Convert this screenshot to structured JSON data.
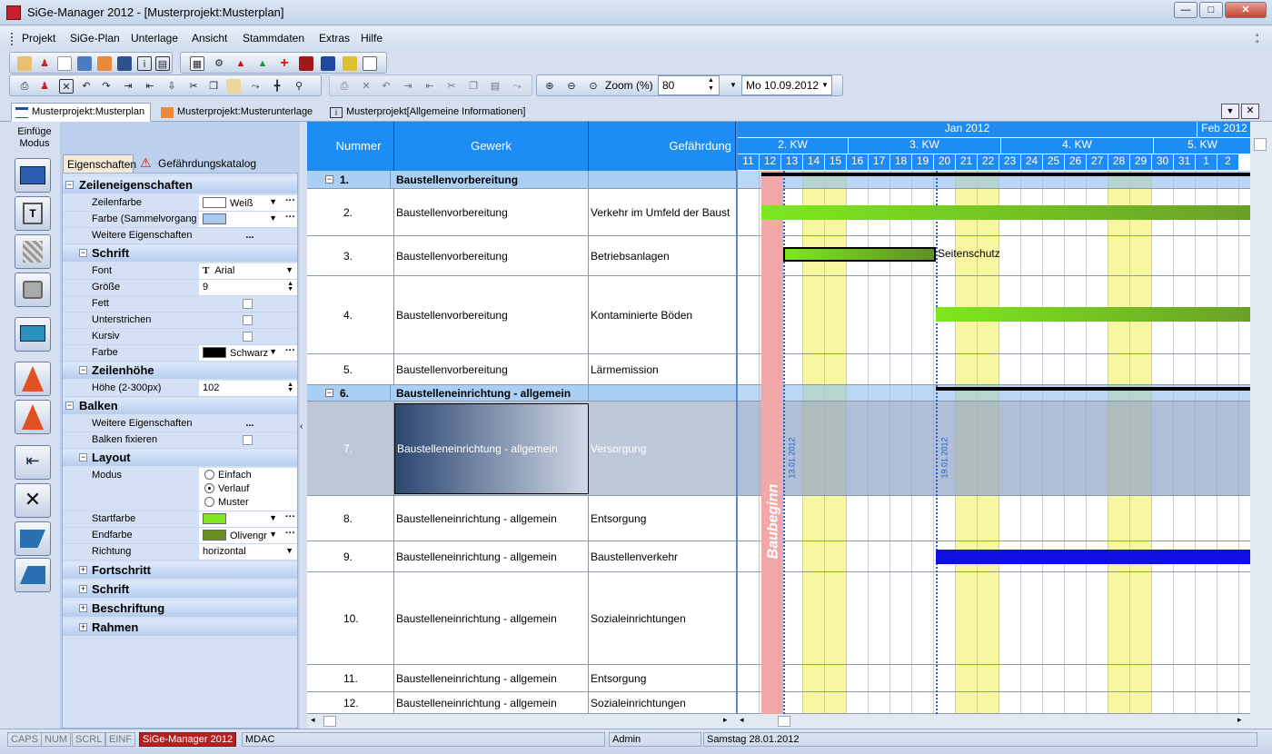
{
  "window": {
    "title": "SiGe-Manager 2012 - [Musterprojekt:Musterplan]"
  },
  "menu": [
    "Projekt",
    "SiGe-Plan",
    "Unterlage",
    "Ansicht",
    "Stammdaten",
    "Extras",
    "Hilfe"
  ],
  "toolbar": {
    "zoom_label": "Zoom (%)",
    "zoom_value": "80",
    "date_value": "Mo 10.09.2012"
  },
  "doc_tabs": [
    {
      "label": "Musterprojekt:Musterplan",
      "active": true
    },
    {
      "label": "Musterprojekt:Musterunterlage",
      "active": false
    },
    {
      "label": "Musterprojekt[Allgemeine Informationen]",
      "active": false
    }
  ],
  "left_panel": {
    "mode_label": "Einfüge Modus"
  },
  "prop_tabs": {
    "properties": "Eigenschaften",
    "catalog": "Gefährdungskatalog"
  },
  "properties": {
    "zeileneigenschaften": "Zeileneigenschaften",
    "zeilenfarbe": {
      "name": "Zeilenfarbe",
      "value": "Weiß",
      "color": "#ffffff"
    },
    "farbe_sammel": {
      "name": "Farbe (Sammelvorgang)",
      "color": "#a8c8f0"
    },
    "weitere": {
      "name": "Weitere Eigenschaften",
      "value": "..."
    },
    "schrift": "Schrift",
    "font": {
      "name": "Font",
      "value": "Arial"
    },
    "groesse": {
      "name": "Größe",
      "value": "9"
    },
    "fett": "Fett",
    "unterstrichen": "Unterstrichen",
    "kursiv": "Kursiv",
    "farbe": {
      "name": "Farbe",
      "value": "Schwarz",
      "color": "#000000"
    },
    "zeilenhoehe": "Zeilenhöhe",
    "hoehe": {
      "name": "Höhe (2-300px)",
      "value": "102"
    },
    "balken": "Balken",
    "balken_weitere": {
      "name": "Weitere Eigenschaften",
      "value": "..."
    },
    "balken_fixieren": "Balken fixieren",
    "layout": "Layout",
    "modus": {
      "name": "Modus",
      "options": [
        "Einfach",
        "Verlauf",
        "Muster"
      ],
      "selected": "Verlauf"
    },
    "startfarbe": {
      "name": "Startfarbe",
      "color": "#80e820"
    },
    "endfarbe": {
      "name": "Endfarbe",
      "value": "Olivengr",
      "color": "#6b8e23"
    },
    "richtung": {
      "name": "Richtung",
      "value": "horizontal"
    },
    "fortschritt": "Fortschritt",
    "schrift2": "Schrift",
    "beschriftung": "Beschriftung",
    "rahmen": "Rahmen"
  },
  "grid": {
    "columns": [
      "Nummer",
      "Gewerk",
      "Gefährdung"
    ],
    "rows": [
      {
        "nr": "1.",
        "gewerk": "Baustellenvorbereitung",
        "gef": "",
        "summary": true
      },
      {
        "nr": "2.",
        "gewerk": "Baustellenvorbereitung",
        "gef": "Verkehr im Umfeld der Baust"
      },
      {
        "nr": "3.",
        "gewerk": "Baustellenvorbereitung",
        "gef": "Betriebsanlagen"
      },
      {
        "nr": "4.",
        "gewerk": "Baustellenvorbereitung",
        "gef": "Kontaminierte Böden"
      },
      {
        "nr": "5.",
        "gewerk": "Baustellenvorbereitung",
        "gef": "Lärmemission"
      },
      {
        "nr": "6.",
        "gewerk": "Baustelleneinrichtung - allgemein",
        "gef": "",
        "summary": true
      },
      {
        "nr": "7.",
        "gewerk": "Baustelleneinrichtung - allgemein",
        "gef": "Versorgung",
        "selected": true
      },
      {
        "nr": "8.",
        "gewerk": "Baustelleneinrichtung - allgemein",
        "gef": "Entsorgung"
      },
      {
        "nr": "9.",
        "gewerk": "Baustelleneinrichtung - allgemein",
        "gef": "Baustellenverkehr"
      },
      {
        "nr": "10.",
        "gewerk": "Baustelleneinrichtung - allgemein",
        "gef": "Sozialeinrichtungen"
      },
      {
        "nr": "11.",
        "gewerk": "Baustelleneinrichtung - allgemein",
        "gef": "Entsorgung"
      },
      {
        "nr": "12.",
        "gewerk": "Baustelleneinrichtung - allgemein",
        "gef": "Sozialeinrichtungen"
      }
    ]
  },
  "gantt": {
    "months": [
      "Jan 2012",
      "Feb 2012"
    ],
    "weeks": [
      "2. KW",
      "3. KW",
      "4. KW",
      "5. KW"
    ],
    "days": [
      "11",
      "12",
      "13",
      "14",
      "15",
      "16",
      "17",
      "18",
      "19",
      "20",
      "21",
      "22",
      "23",
      "24",
      "25",
      "26",
      "27",
      "28",
      "29",
      "30",
      "31",
      "1",
      "2"
    ],
    "milestone_label": "Baubeginn",
    "date_markers": [
      "13.01.2012",
      "19.01.2012"
    ],
    "bar_label": "Seitenschutz"
  },
  "status": {
    "caps": "CAPS",
    "num": "NUM",
    "scrl": "SCRL",
    "einf": "EINF",
    "app": "SiGe-Manager 2012",
    "mdac": "MDAC",
    "user": "Admin",
    "date": "Samstag 28.01.2012"
  }
}
